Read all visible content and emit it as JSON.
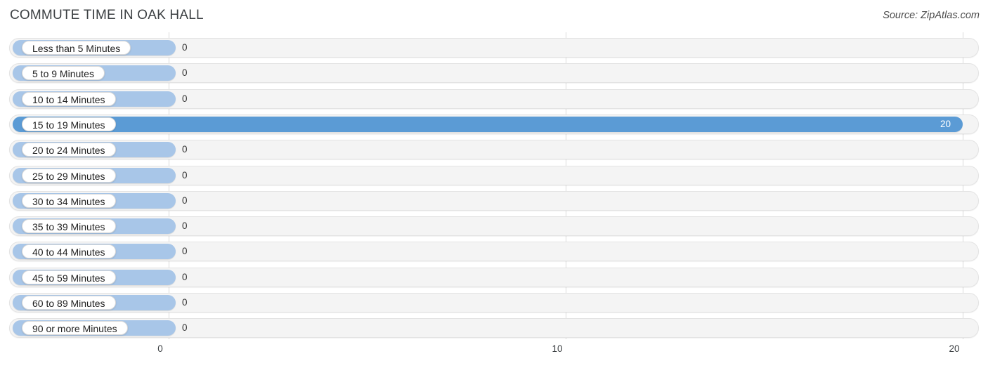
{
  "header": {
    "title": "COMMUTE TIME IN OAK HALL",
    "source": "Source: ZipAtlas.com"
  },
  "chart_data": {
    "type": "bar",
    "orientation": "horizontal",
    "title": "COMMUTE TIME IN OAK HALL",
    "subtitle": "Source: ZipAtlas.com",
    "xlabel": "",
    "ylabel": "",
    "xlim": [
      0,
      20
    ],
    "grid": true,
    "legend": false,
    "xticks": [
      "0",
      "10",
      "20"
    ],
    "xtick_values": [
      0,
      10,
      20
    ],
    "categories": [
      "Less than 5 Minutes",
      "5 to 9 Minutes",
      "10 to 14 Minutes",
      "15 to 19 Minutes",
      "20 to 24 Minutes",
      "25 to 29 Minutes",
      "30 to 34 Minutes",
      "35 to 39 Minutes",
      "40 to 44 Minutes",
      "45 to 59 Minutes",
      "60 to 89 Minutes",
      "90 or more Minutes"
    ],
    "values": [
      0,
      0,
      0,
      20,
      0,
      0,
      0,
      0,
      0,
      0,
      0,
      0
    ],
    "value_labels": [
      "0",
      "0",
      "0",
      "20",
      "0",
      "0",
      "0",
      "0",
      "0",
      "0",
      "0",
      "0"
    ],
    "highlighted_category": "15 to 19 Minutes",
    "colors": {
      "bar": "#a8c6e8",
      "bar_highlight": "#5b9bd5",
      "track": "#f4f4f4",
      "track_border": "#e3e3e3",
      "gridline": "#d9d9d9",
      "pill_background": "#ffffff",
      "text": "#3c4043",
      "value_text_inside": "#ffffff"
    }
  },
  "rows": [
    {
      "label": "Less than 5 Minutes",
      "value": 0,
      "value_label": "0",
      "highlight": false
    },
    {
      "label": "5 to 9 Minutes",
      "value": 0,
      "value_label": "0",
      "highlight": false
    },
    {
      "label": "10 to 14 Minutes",
      "value": 0,
      "value_label": "0",
      "highlight": false
    },
    {
      "label": "15 to 19 Minutes",
      "value": 20,
      "value_label": "20",
      "highlight": true
    },
    {
      "label": "20 to 24 Minutes",
      "value": 0,
      "value_label": "0",
      "highlight": false
    },
    {
      "label": "25 to 29 Minutes",
      "value": 0,
      "value_label": "0",
      "highlight": false
    },
    {
      "label": "30 to 34 Minutes",
      "value": 0,
      "value_label": "0",
      "highlight": false
    },
    {
      "label": "35 to 39 Minutes",
      "value": 0,
      "value_label": "0",
      "highlight": false
    },
    {
      "label": "40 to 44 Minutes",
      "value": 0,
      "value_label": "0",
      "highlight": false
    },
    {
      "label": "45 to 59 Minutes",
      "value": 0,
      "value_label": "0",
      "highlight": false
    },
    {
      "label": "60 to 89 Minutes",
      "value": 0,
      "value_label": "0",
      "highlight": false
    },
    {
      "label": "90 or more Minutes",
      "value": 0,
      "value_label": "0",
      "highlight": false
    }
  ],
  "axis": {
    "ticks": [
      {
        "label": "0",
        "value": 0
      },
      {
        "label": "10",
        "value": 10
      },
      {
        "label": "20",
        "value": 20
      }
    ]
  }
}
